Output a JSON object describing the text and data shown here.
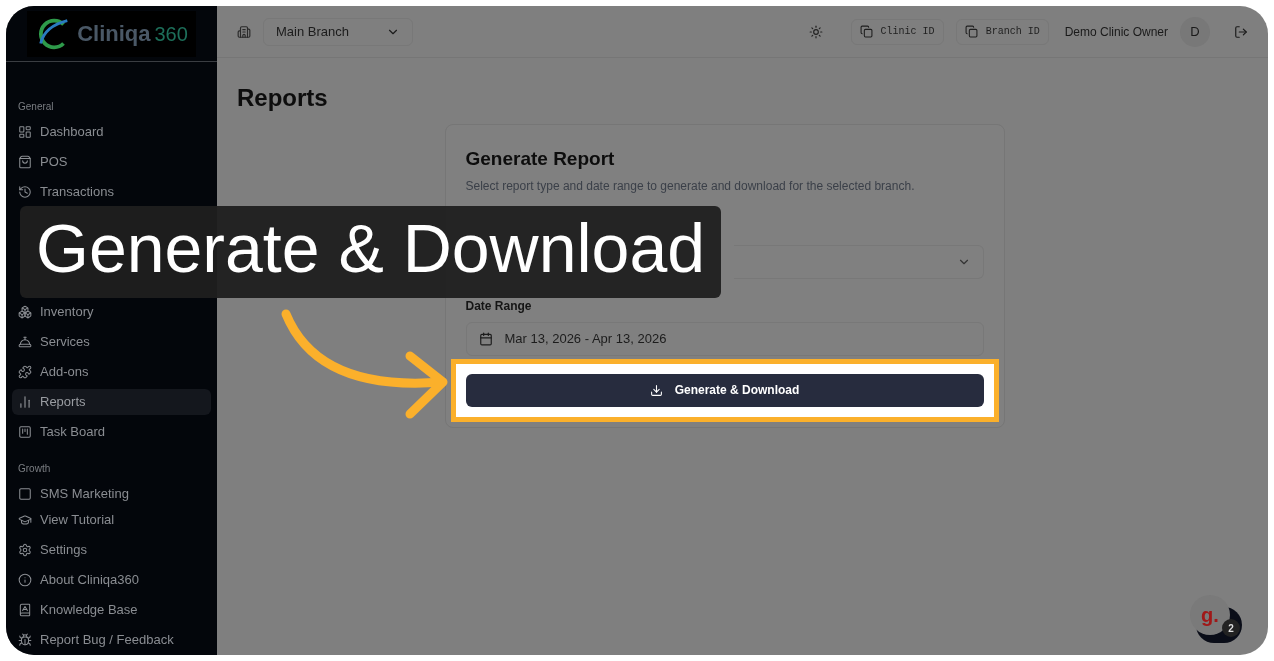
{
  "logo": {
    "name": "Cliniqa",
    "suffix": "360"
  },
  "sidebar": {
    "sections": [
      {
        "title": "General",
        "items": [
          {
            "label": "Dashboard",
            "selected": false
          },
          {
            "label": "POS",
            "selected": false
          },
          {
            "label": "Transactions",
            "selected": false
          },
          {
            "label": "Inventory",
            "selected": false
          },
          {
            "label": "Services",
            "selected": false
          },
          {
            "label": "Add-ons",
            "selected": false
          },
          {
            "label": "Reports",
            "selected": true
          },
          {
            "label": "Task Board",
            "selected": false
          }
        ]
      },
      {
        "title": "Growth",
        "items": [
          {
            "label": "SMS Marketing",
            "selected": false
          }
        ]
      }
    ],
    "footer_items": [
      {
        "label": "View Tutorial"
      },
      {
        "label": "Settings"
      },
      {
        "label": "About Cliniqa360"
      },
      {
        "label": "Knowledge Base"
      },
      {
        "label": "Report Bug / Feedback"
      }
    ]
  },
  "topbar": {
    "branch_select": "Main Branch",
    "copy_buttons": [
      "Clinic ID",
      "Branch ID"
    ],
    "user_name": "Demo Clinic Owner",
    "avatar_initial": "D"
  },
  "page_title": "Reports",
  "card": {
    "title": "Generate Report",
    "description": "Select report type and date range to generate and download for the selected branch.",
    "fields": [
      {
        "kind": "select"
      },
      {
        "kind": "date",
        "label": "Date Range",
        "value": "Mar 13, 2026 - Apr 13, 2026"
      }
    ],
    "button": "Generate & Download"
  },
  "tutorial": {
    "caption": "Generate & Download"
  },
  "help_widget": {
    "logo": "g.",
    "badge": "2"
  }
}
